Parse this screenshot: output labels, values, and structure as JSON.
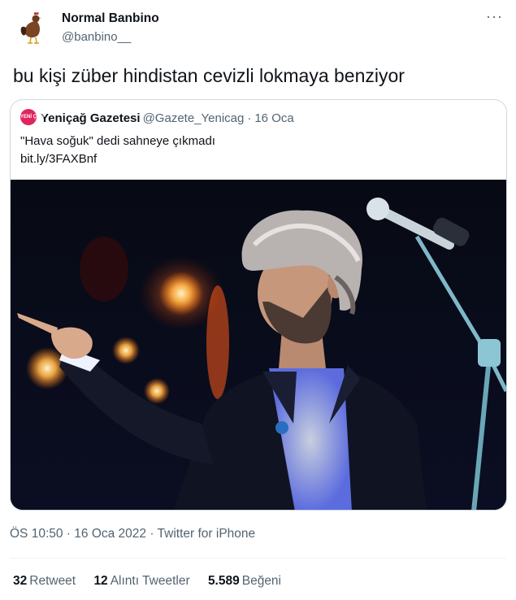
{
  "tweet": {
    "author_name": "Normal Banbino",
    "author_handle": "@banbino__",
    "text": "bu kişi züber hindistan cevizli lokmaya benziyor",
    "more_icon": "more-icon"
  },
  "quoted": {
    "avatar_text": "YENİ ÇAĞ",
    "name": "Yeniçağ Gazetesi",
    "handle": "@Gazete_Yenicag",
    "separator": "·",
    "date": "16 Oca",
    "text": "\"Hava soğuk\" dedi sahneye çıkmadı",
    "link": "bit.ly/3FAXBnf",
    "accent_color": "#e0245e"
  },
  "meta": {
    "time": "ÖS 10:50",
    "sep1": " · ",
    "date": "16 Oca 2022",
    "sep2": " · ",
    "source": "Twitter for iPhone"
  },
  "stats": {
    "retweets_count": "32",
    "retweets_label": "Retweet",
    "quotes_count": "12",
    "quotes_label": "Alıntı Tweetler",
    "likes_count": "5.589",
    "likes_label": "Beğeni"
  },
  "colors": {
    "text_primary": "#0f1419",
    "text_secondary": "#536471",
    "border": "#cfd9de"
  }
}
